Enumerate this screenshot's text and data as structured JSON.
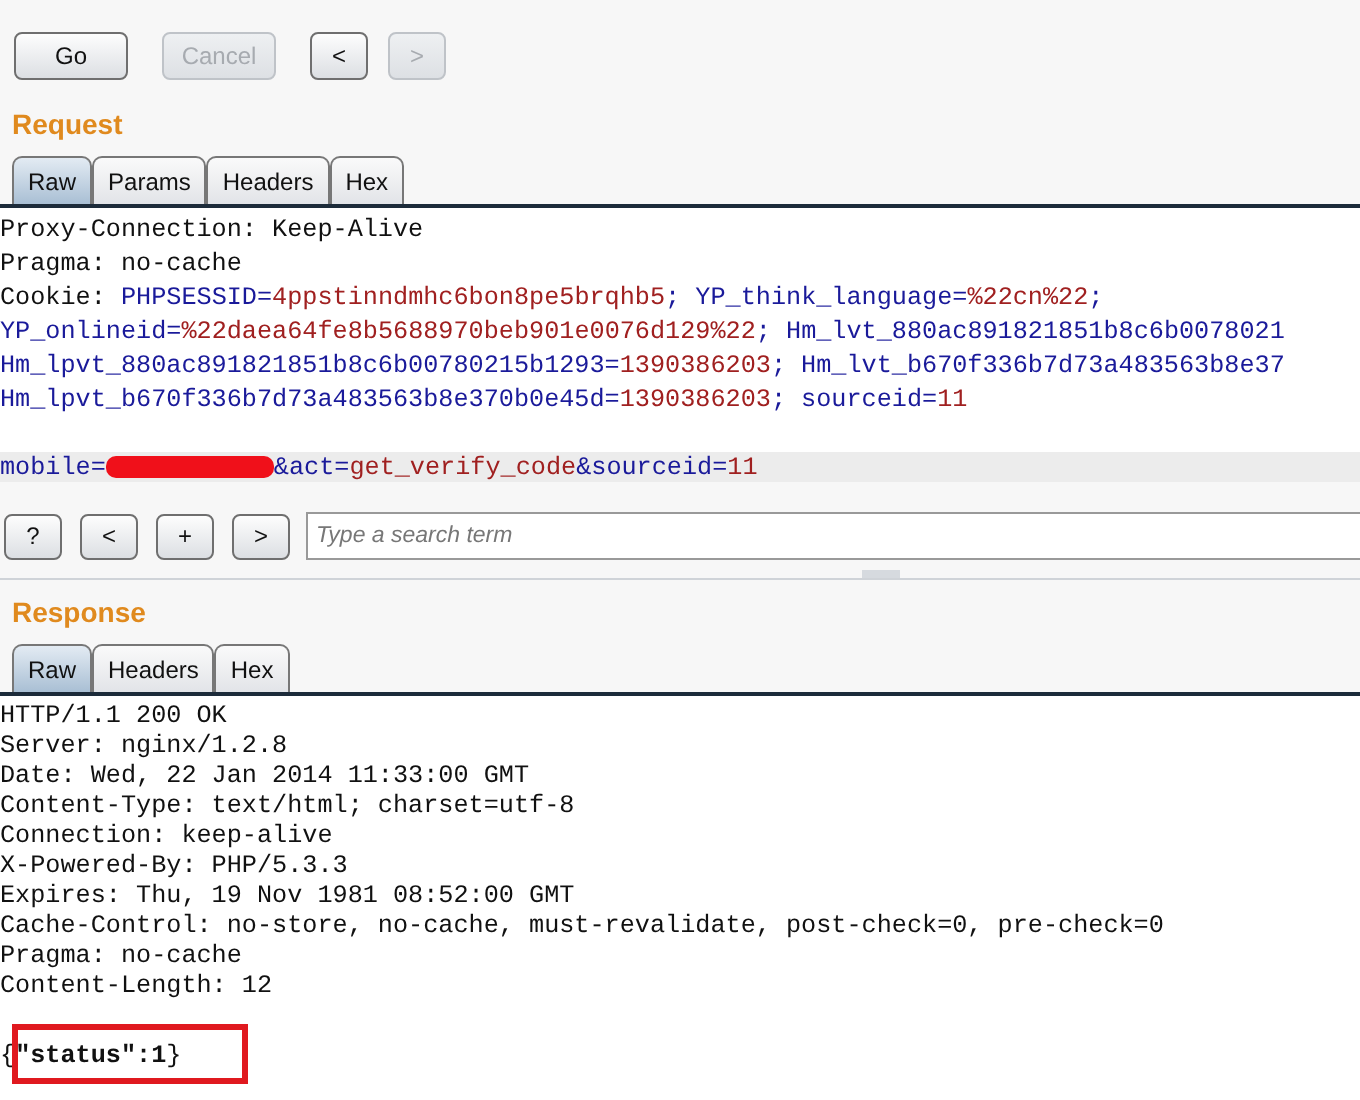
{
  "toolbar": {
    "buttons": [
      {
        "label": "Go",
        "disabled": false
      },
      {
        "label": "Cancel",
        "disabled": true
      },
      {
        "label": "<",
        "disabled": false
      },
      {
        "label": ">",
        "disabled": true
      }
    ]
  },
  "request": {
    "title": "Request",
    "tabs": [
      {
        "label": "Raw",
        "selected": true
      },
      {
        "label": "Params",
        "selected": false
      },
      {
        "label": "Headers",
        "selected": false
      },
      {
        "label": "Hex",
        "selected": false
      }
    ],
    "lines": [
      {
        "highlighted": false,
        "segments": [
          {
            "kind": "text",
            "text": "Proxy-Connection: Keep-Alive"
          }
        ]
      },
      {
        "highlighted": false,
        "segments": [
          {
            "kind": "text",
            "text": "Pragma: no-cache"
          }
        ]
      },
      {
        "highlighted": false,
        "segments": [
          {
            "kind": "text",
            "text": "Cookie: "
          },
          {
            "kind": "key",
            "text": "PHPSESSID="
          },
          {
            "kind": "value",
            "text": "4ppstinndmhc6bon8pe5brqhb5"
          },
          {
            "kind": "key",
            "text": "; YP_think_language="
          },
          {
            "kind": "value",
            "text": "%22cn%22"
          },
          {
            "kind": "key",
            "text": ";"
          }
        ]
      },
      {
        "highlighted": false,
        "segments": [
          {
            "kind": "key",
            "text": "YP_onlineid="
          },
          {
            "kind": "value",
            "text": "%22daea64fe8b5688970beb901e0076d129%22"
          },
          {
            "kind": "key",
            "text": "; Hm_lvt_880ac891821851b8c6b0078021"
          }
        ]
      },
      {
        "highlighted": false,
        "segments": [
          {
            "kind": "key",
            "text": "Hm_lpvt_880ac891821851b8c6b00780215b1293="
          },
          {
            "kind": "value",
            "text": "1390386203"
          },
          {
            "kind": "key",
            "text": "; Hm_lvt_b670f336b7d73a483563b8e37"
          }
        ]
      },
      {
        "highlighted": false,
        "segments": [
          {
            "kind": "key",
            "text": "Hm_lpvt_b670f336b7d73a483563b8e370b0e45d="
          },
          {
            "kind": "value",
            "text": "1390386203"
          },
          {
            "kind": "key",
            "text": "; sourceid="
          },
          {
            "kind": "value",
            "text": "11"
          }
        ]
      },
      {
        "highlighted": false
      },
      {
        "highlighted": true,
        "segments": [
          {
            "kind": "key",
            "text": "mobile="
          },
          {
            "kind": "redacted"
          },
          {
            "kind": "key",
            "text": "&act="
          },
          {
            "kind": "value",
            "text": "get_verify_code"
          },
          {
            "kind": "key",
            "text": "&sourceid="
          },
          {
            "kind": "value",
            "text": "11"
          }
        ]
      }
    ]
  },
  "search": {
    "buttons": [
      "?",
      "<",
      "+",
      ">"
    ],
    "placeholder": "Type a search term"
  },
  "response": {
    "title": "Response",
    "tabs": [
      {
        "label": "Raw",
        "selected": true
      },
      {
        "label": "Headers",
        "selected": false
      },
      {
        "label": "Hex",
        "selected": false
      }
    ],
    "lines": [
      "HTTP/1.1 200 OK",
      "Server: nginx/1.2.8",
      "Date: Wed, 22 Jan 2014 11:33:00 GMT",
      "Content-Type: text/html; charset=utf-8",
      "Connection: keep-alive",
      "X-Powered-By: PHP/5.3.3",
      "Expires: Thu, 19 Nov 1981 08:52:00 GMT",
      "Cache-Control: no-store, no-cache, must-revalidate, post-check=0, pre-check=0",
      "Pragma: no-cache",
      "Content-Length: 12"
    ],
    "body": "{**\"status\":1**}"
  }
}
